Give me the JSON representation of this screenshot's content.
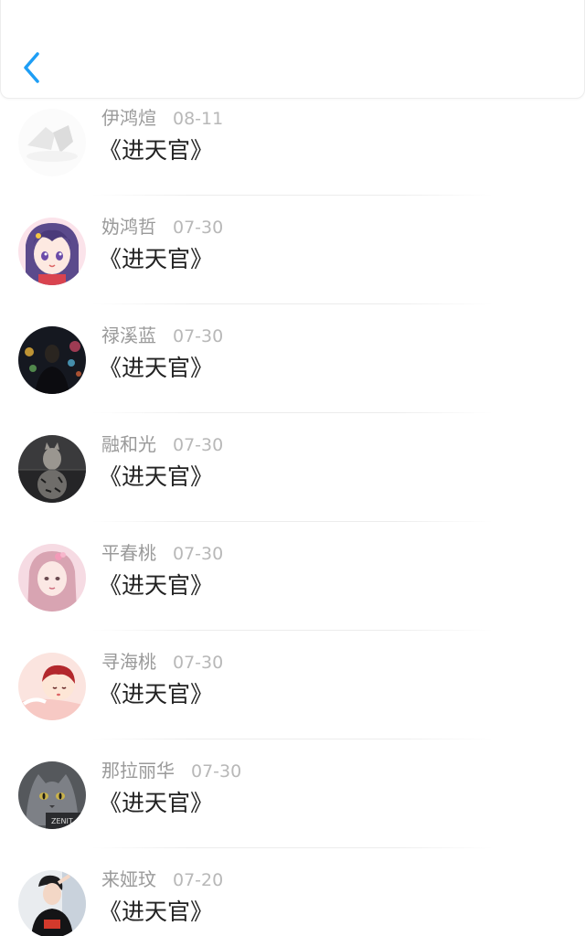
{
  "header": {
    "back_icon": "chevron-left-icon",
    "accent_color": "#1e9ef5"
  },
  "comments": [
    {
      "name": "伊鸿煊",
      "date": "08-11",
      "title": "《进天官》",
      "avatar": "faded-hands-photo"
    },
    {
      "name": "妫鸿哲",
      "date": "07-30",
      "title": "《进天官》",
      "avatar": "anime-girl-avatar"
    },
    {
      "name": "禄溪蓝",
      "date": "07-30",
      "title": "《进天官》",
      "avatar": "night-city-man-avatar"
    },
    {
      "name": "融和光",
      "date": "07-30",
      "title": "《进天官》",
      "avatar": "cat-tiger-reflection-avatar"
    },
    {
      "name": "平春桃",
      "date": "07-30",
      "title": "《进天官》",
      "avatar": "pink-fairy-avatar"
    },
    {
      "name": "寻海桃",
      "date": "07-30",
      "title": "《进天官》",
      "avatar": "cartoon-sleeping-girl-avatar"
    },
    {
      "name": "那拉丽华",
      "date": "07-30",
      "title": "《进天官》",
      "avatar": "gray-cat-avatar"
    },
    {
      "name": "来娅玟",
      "date": "07-20",
      "title": "《进天官》",
      "avatar": "boy-photo-avatar"
    }
  ]
}
